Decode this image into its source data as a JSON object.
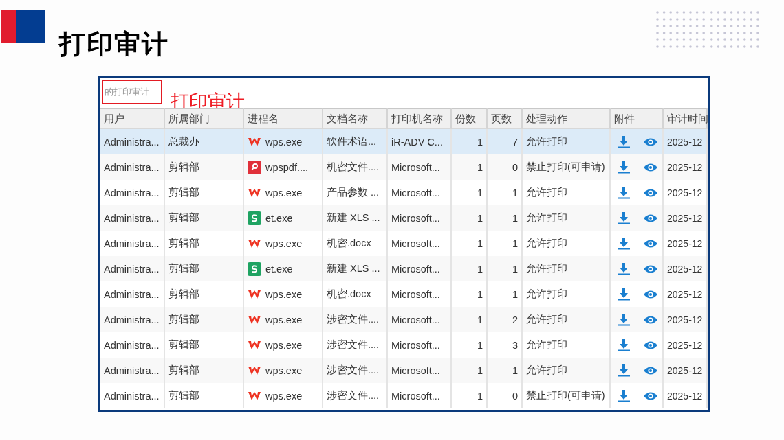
{
  "slide": {
    "title": "打印审计"
  },
  "window": {
    "search": {
      "value": "的打印审计"
    },
    "annotation": "打印审计",
    "table": {
      "columns": [
        "用户",
        "所属部门",
        "进程名",
        "文档名称",
        "打印机名称",
        "份数",
        "页数",
        "处理动作",
        "附件",
        "审计时间"
      ],
      "rows": [
        {
          "selected": true,
          "user": "Administra...",
          "department": "总裁办",
          "process": "wps.exe",
          "kind": "wps",
          "document": "软件术语...",
          "printer": "iR-ADV C...",
          "copies": "1",
          "pages": "7",
          "action": "允许打印",
          "time": "2025-12"
        },
        {
          "selected": false,
          "user": "Administra...",
          "department": "剪辑部",
          "process": "wpspdf....",
          "kind": "pdf",
          "document": "机密文件....",
          "printer": "Microsoft...",
          "copies": "1",
          "pages": "0",
          "action": "禁止打印(可申请)",
          "time": "2025-12"
        },
        {
          "selected": false,
          "user": "Administra...",
          "department": "剪辑部",
          "process": "wps.exe",
          "kind": "wps",
          "document": "产品参数 ...",
          "printer": "Microsoft...",
          "copies": "1",
          "pages": "1",
          "action": "允许打印",
          "time": "2025-12"
        },
        {
          "selected": false,
          "user": "Administra...",
          "department": "剪辑部",
          "process": "et.exe",
          "kind": "et",
          "document": "新建 XLS ...",
          "printer": "Microsoft...",
          "copies": "1",
          "pages": "1",
          "action": "允许打印",
          "time": "2025-12"
        },
        {
          "selected": false,
          "user": "Administra...",
          "department": "剪辑部",
          "process": "wps.exe",
          "kind": "wps",
          "document": "机密.docx",
          "printer": "Microsoft...",
          "copies": "1",
          "pages": "1",
          "action": "允许打印",
          "time": "2025-12"
        },
        {
          "selected": false,
          "user": "Administra...",
          "department": "剪辑部",
          "process": "et.exe",
          "kind": "et",
          "document": "新建 XLS ...",
          "printer": "Microsoft...",
          "copies": "1",
          "pages": "1",
          "action": "允许打印",
          "time": "2025-12"
        },
        {
          "selected": false,
          "user": "Administra...",
          "department": "剪辑部",
          "process": "wps.exe",
          "kind": "wps",
          "document": "机密.docx",
          "printer": "Microsoft...",
          "copies": "1",
          "pages": "1",
          "action": "允许打印",
          "time": "2025-12"
        },
        {
          "selected": false,
          "user": "Administra...",
          "department": "剪辑部",
          "process": "wps.exe",
          "kind": "wps",
          "document": "涉密文件....",
          "printer": "Microsoft...",
          "copies": "1",
          "pages": "2",
          "action": "允许打印",
          "time": "2025-12"
        },
        {
          "selected": false,
          "user": "Administra...",
          "department": "剪辑部",
          "process": "wps.exe",
          "kind": "wps",
          "document": "涉密文件....",
          "printer": "Microsoft...",
          "copies": "1",
          "pages": "3",
          "action": "允许打印",
          "time": "2025-12"
        },
        {
          "selected": false,
          "user": "Administra...",
          "department": "剪辑部",
          "process": "wps.exe",
          "kind": "wps",
          "document": "涉密文件....",
          "printer": "Microsoft...",
          "copies": "1",
          "pages": "1",
          "action": "允许打印",
          "time": "2025-12"
        },
        {
          "selected": false,
          "user": "Administra...",
          "department": "剪辑部",
          "process": "wps.exe",
          "kind": "wps",
          "document": "涉密文件....",
          "printer": "Microsoft...",
          "copies": "1",
          "pages": "0",
          "action": "禁止打印(可申请)",
          "time": "2025-12"
        }
      ]
    }
  }
}
